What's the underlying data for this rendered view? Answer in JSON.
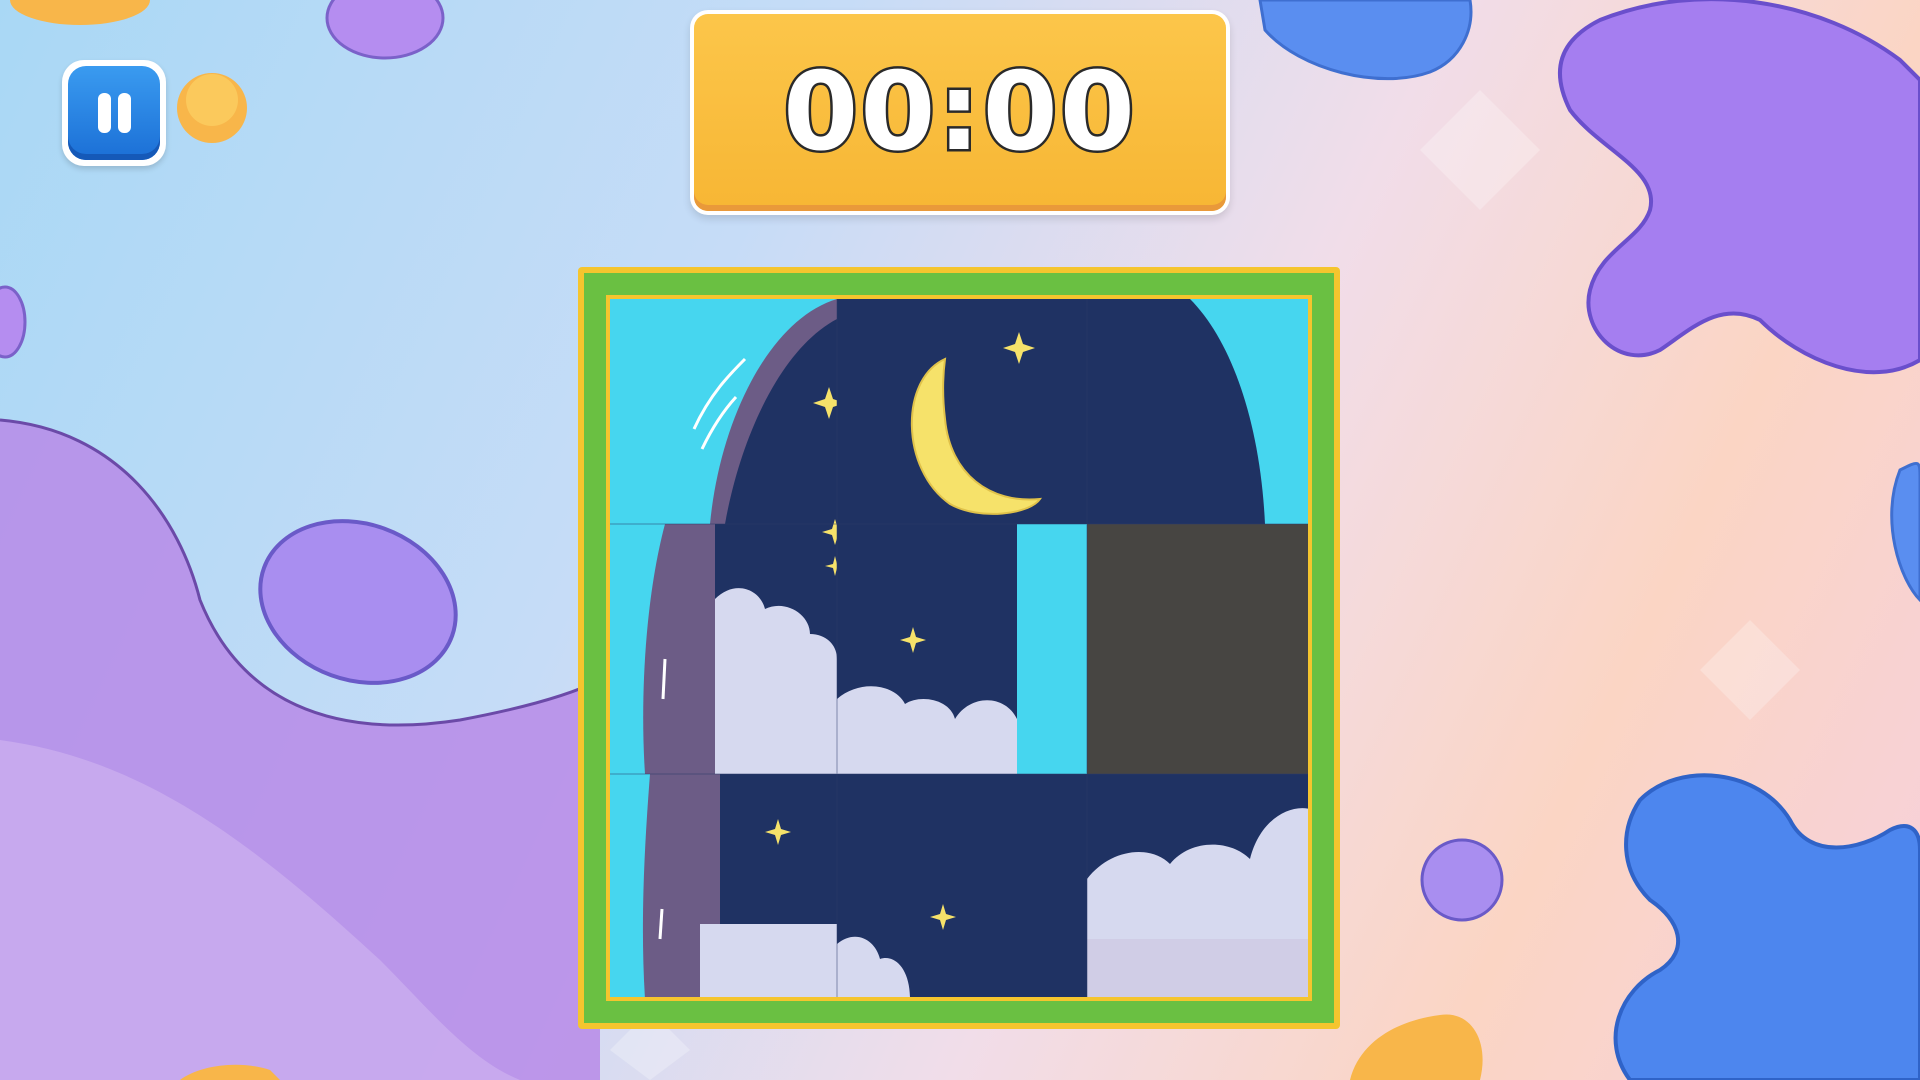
{
  "game": {
    "timer": "00:00",
    "pause_icon": "pause-icon",
    "board": {
      "rows": 3,
      "cols": 3,
      "empty_tile": {
        "row": 1,
        "col": 2
      }
    },
    "colors": {
      "pause_button": "#2a86e6",
      "timer_bg": "#f9bd3e",
      "board_border": "#6ac042",
      "board_frame": "#f5c52e",
      "sky": "#1f3263",
      "empty_tile": "#474542"
    }
  }
}
